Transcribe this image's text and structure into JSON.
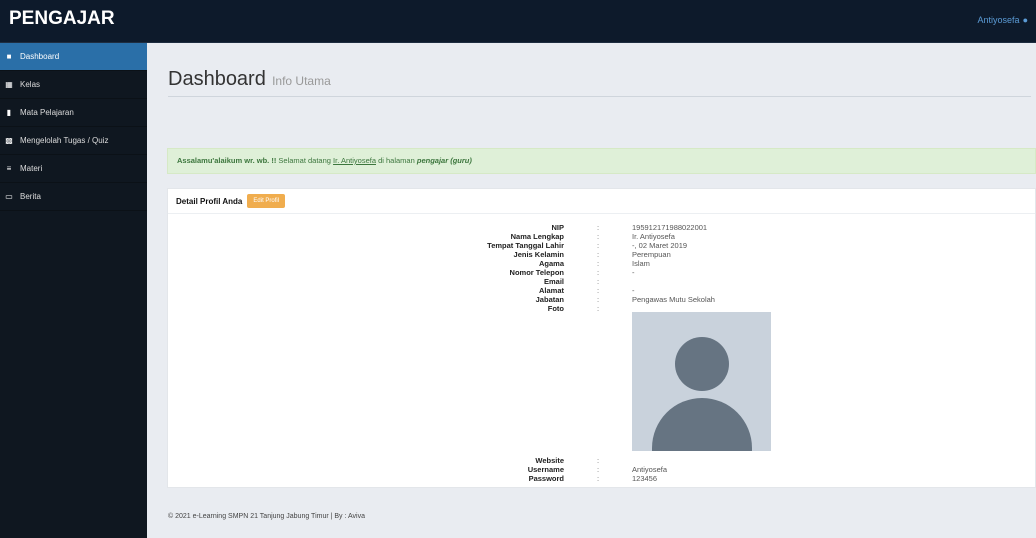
{
  "brand": "PENGAJAR",
  "user": {
    "name": "Antiyosefa",
    "icon": "user-icon"
  },
  "sidebar": {
    "items": [
      {
        "label": "Dashboard",
        "icon": "dashboard-icon",
        "active": true
      },
      {
        "label": "Kelas",
        "icon": "table-icon"
      },
      {
        "label": "Mata Pelajaran",
        "icon": "file-icon"
      },
      {
        "label": "Mengelolah Tugas / Quiz",
        "icon": "bar-chart-icon"
      },
      {
        "label": "Materi",
        "icon": "list-icon"
      },
      {
        "label": "Berita",
        "icon": "monitor-icon"
      }
    ]
  },
  "header": {
    "title": "Dashboard",
    "subtitle": "Info Utama"
  },
  "alert": {
    "greeting": "Assalamu'alaikum wr. wb. !!",
    "text1": " Selamat datang ",
    "name": "Ir. Antiyosefa",
    "text2": " di halaman ",
    "role": "pengajar (guru)"
  },
  "panel": {
    "title": "Detail Profil Anda",
    "edit_label": "Edit Profil"
  },
  "profile": [
    {
      "label": "NIP",
      "value": "195912171988022001"
    },
    {
      "label": "Nama Lengkap",
      "value": "Ir. Antiyosefa"
    },
    {
      "label": "Tempat Tanggal Lahir",
      "value": "-, 02 Maret 2019"
    },
    {
      "label": "Jenis Kelamin",
      "value": "Perempuan"
    },
    {
      "label": "Agama",
      "value": "Islam"
    },
    {
      "label": "Nomor Telepon",
      "value": "-"
    },
    {
      "label": "Email",
      "value": ""
    },
    {
      "label": "Alamat",
      "value": "-"
    },
    {
      "label": "Jabatan",
      "value": "Pengawas Mutu Sekolah"
    },
    {
      "label": "Foto",
      "value": ""
    },
    {
      "label": "Website",
      "value": ""
    },
    {
      "label": "Username",
      "value": "Antiyosefa"
    },
    {
      "label": "Password",
      "value": "123456"
    }
  ],
  "separator": ":",
  "footer": "© 2021 e-Learning SMPN 21 Tanjung Jabung Timur | By : Aviva",
  "colors": {
    "topbar": "#0d1a2b",
    "sidebar": "#0f1720",
    "active": "#2a6fa8",
    "alert_bg": "#dff0d8",
    "edit_button": "#f0ad4e"
  }
}
